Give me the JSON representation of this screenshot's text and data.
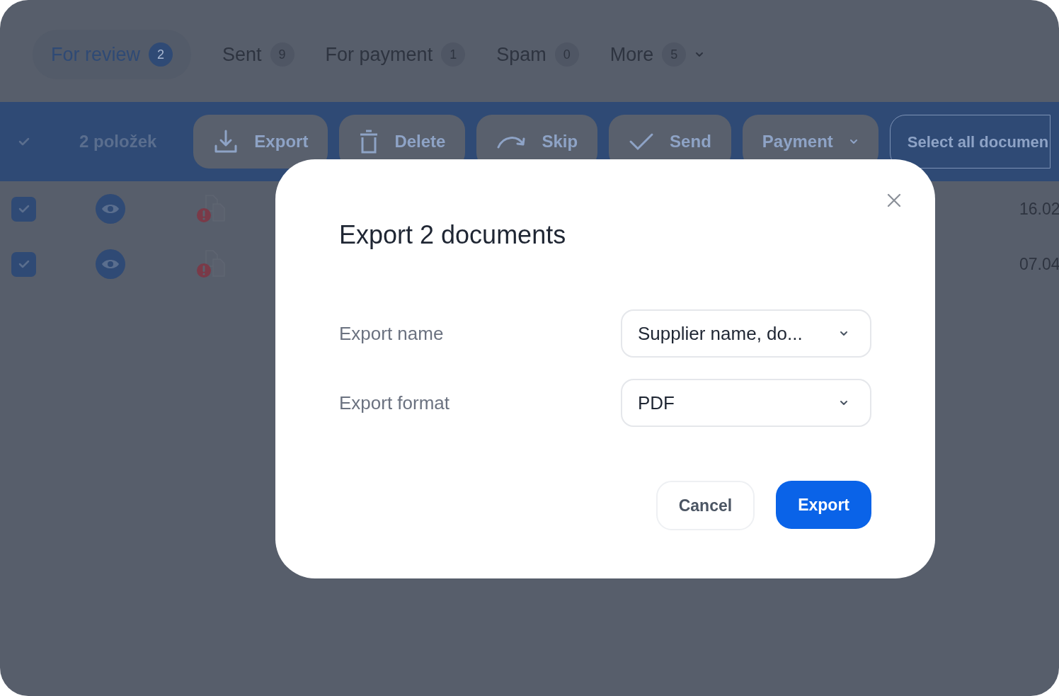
{
  "tabs": [
    {
      "label": "For review",
      "count": "2",
      "selected": true,
      "dropdown": false
    },
    {
      "label": "Sent",
      "count": "9",
      "selected": false,
      "dropdown": false
    },
    {
      "label": "For payment",
      "count": "1",
      "selected": false,
      "dropdown": false
    },
    {
      "label": "Spam",
      "count": "0",
      "selected": false,
      "dropdown": false
    },
    {
      "label": "More",
      "count": "5",
      "selected": false,
      "dropdown": true
    }
  ],
  "toolbar": {
    "select_all_checked": true,
    "count_label": "2 položek",
    "actions": [
      {
        "kind": "export",
        "label": "Export"
      },
      {
        "kind": "delete",
        "label": "Delete"
      },
      {
        "kind": "skip",
        "label": "Skip"
      },
      {
        "kind": "send",
        "label": "Send"
      },
      {
        "kind": "payment",
        "label": "Payment"
      }
    ],
    "select_all_button": "Select all documen"
  },
  "rows": [
    {
      "checked": true,
      "warning": true,
      "date": "16.02"
    },
    {
      "checked": true,
      "warning": true,
      "date": "07.04"
    }
  ],
  "dialog": {
    "title": "Export 2 documents",
    "fields": [
      {
        "label": "Export name",
        "value": "Supplier name, do..."
      },
      {
        "label": "Export format",
        "value": "PDF"
      }
    ],
    "cancel": "Cancel",
    "confirm": "Export"
  }
}
